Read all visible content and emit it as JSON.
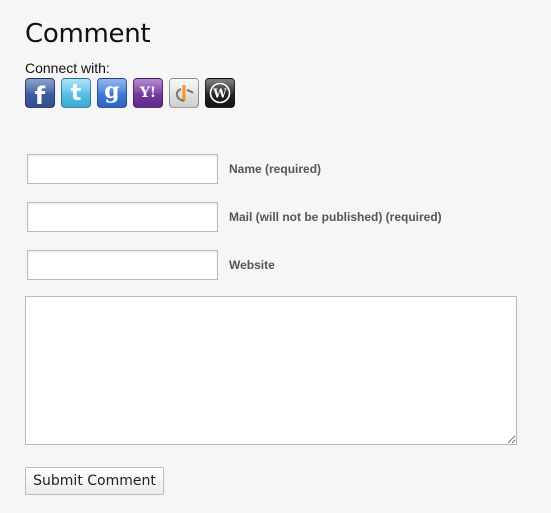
{
  "heading": "Comment",
  "connect": {
    "label": "Connect with:",
    "providers": [
      {
        "name": "facebook",
        "glyph": "f",
        "color": "#3b5998"
      },
      {
        "name": "twitter",
        "glyph": "t",
        "color": "#4cc2ee"
      },
      {
        "name": "google",
        "glyph": "g",
        "color": "#3b73d6"
      },
      {
        "name": "yahoo",
        "glyph": "Y!",
        "color": "#720e9e"
      },
      {
        "name": "openid",
        "glyph": "openid-logo",
        "color": "#f7931e"
      },
      {
        "name": "wordpress",
        "glyph": "W",
        "color": "#222222"
      }
    ]
  },
  "form": {
    "name_label": "Name (required)",
    "name_value": "",
    "mail_label": "Mail (will not be published) (required)",
    "mail_value": "",
    "website_label": "Website",
    "website_value": "",
    "comment_value": "",
    "submit_label": "Submit Comment"
  }
}
